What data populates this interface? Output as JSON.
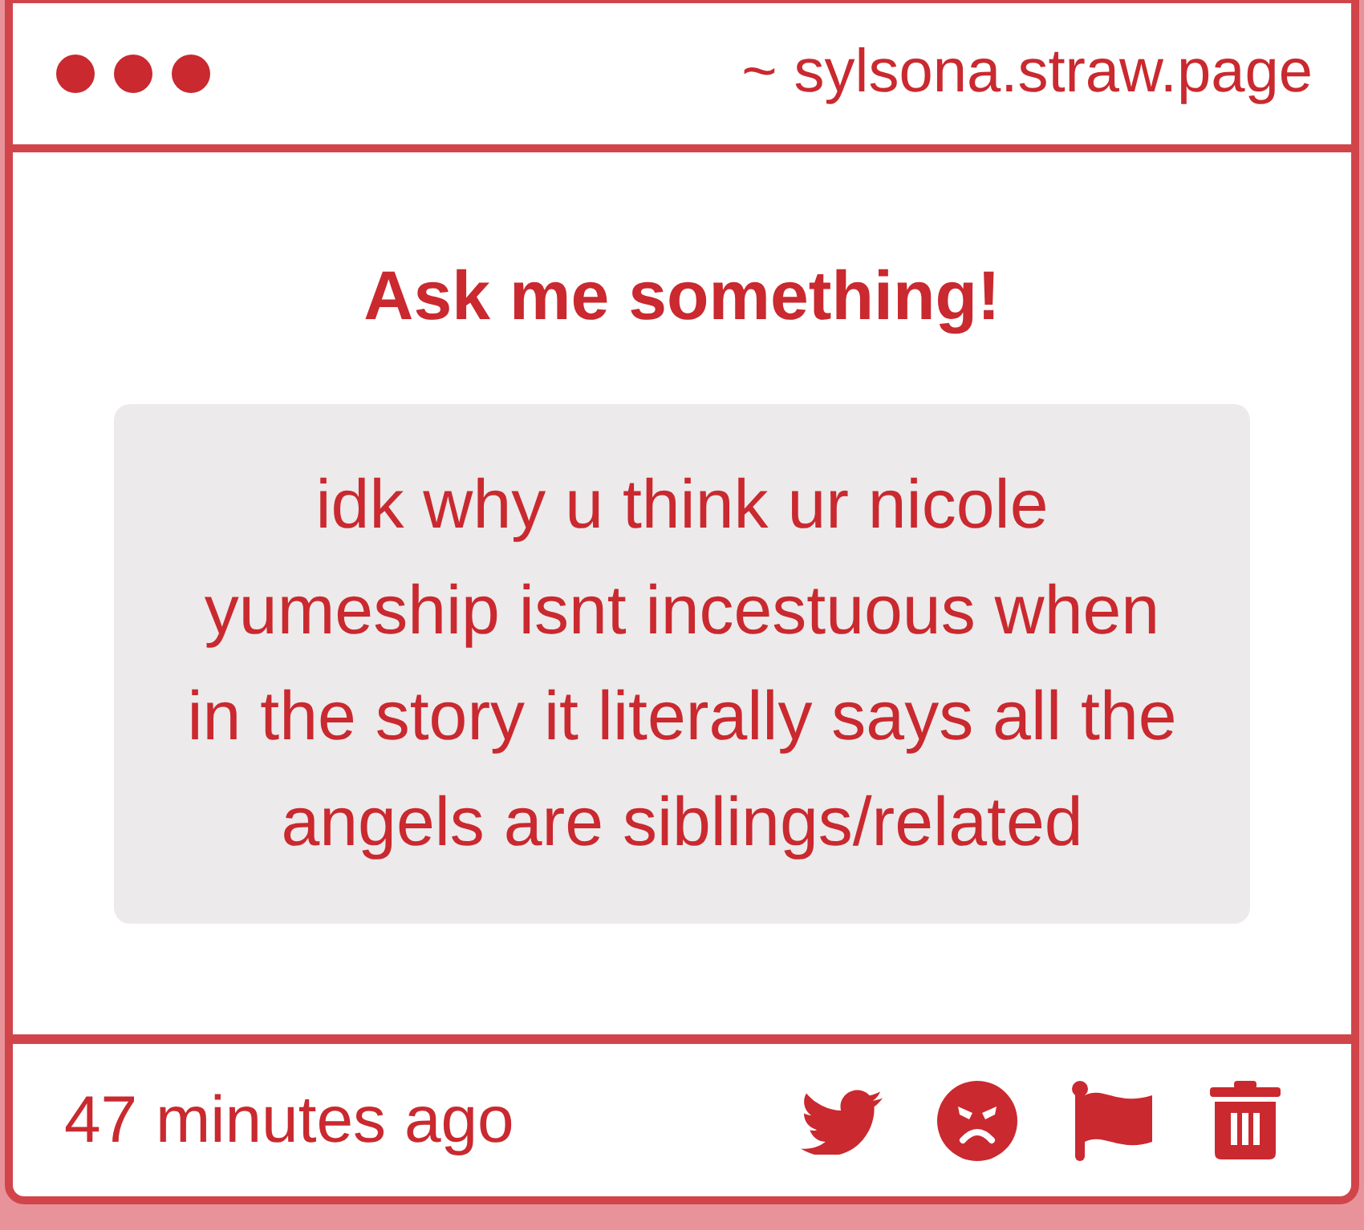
{
  "window": {
    "address": "~ sylsona.straw.page"
  },
  "title": "Ask me something!",
  "question": {
    "text": "idk why u think ur nicole yumeship isnt incestuous when in the story it literally says all the angels are siblings/related"
  },
  "footer": {
    "time": "47 minutes ago"
  }
}
